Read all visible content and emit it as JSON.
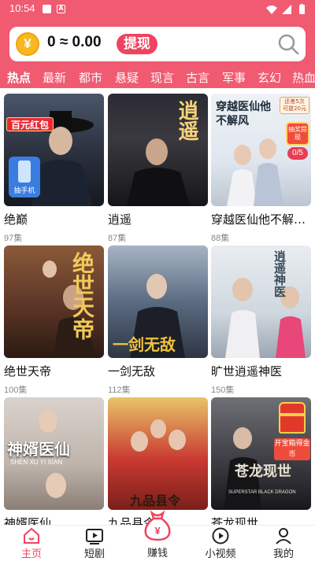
{
  "status_bar": {
    "time": "10:54",
    "notif_badge": "A"
  },
  "header": {
    "coin_symbol": "¥",
    "balance_text": "0 ≈ 0.00",
    "withdraw_label": "提现",
    "accent_color": "#f05b72"
  },
  "tabs": [
    {
      "label": "热点"
    },
    {
      "label": "最新"
    },
    {
      "label": "都市"
    },
    {
      "label": "悬疑"
    },
    {
      "label": "现言"
    },
    {
      "label": "古言"
    },
    {
      "label": "军事"
    },
    {
      "label": "玄幻"
    },
    {
      "label": "热血"
    }
  ],
  "cards": [
    {
      "title": "绝巅",
      "episodes": "97集",
      "poster_text": "",
      "bg": "#2a2f3c"
    },
    {
      "title": "逍遥",
      "episodes": "87集",
      "poster_text": "逍遥",
      "bg": "#3b3940"
    },
    {
      "title": "穿越医仙他不解风情",
      "episodes": "88集",
      "poster_text": "穿越医仙他不解风",
      "bg": "#dfe6ee"
    },
    {
      "title": "绝世天帝",
      "episodes": "100集",
      "poster_text": "绝世天帝",
      "bg": "#5a3526"
    },
    {
      "title": "一剑无敌",
      "episodes": "112集",
      "poster_text": "一剑无敌",
      "bg": "#5b6b82"
    },
    {
      "title": "旷世逍遥神医",
      "episodes": "150集",
      "poster_text": "逍遥神医",
      "bg": "#cfd7df"
    },
    {
      "title": "神婿医仙",
      "episodes": "",
      "poster_text": "神婿医仙",
      "poster_subtext": "SHEN XU YI XIAN",
      "bg": "#bfb4ac"
    },
    {
      "title": "九品县令",
      "episodes": "",
      "poster_text": "九品县令",
      "bg": "#c93a32"
    },
    {
      "title": "苍龙现世",
      "episodes": "",
      "poster_text": "苍龙现世",
      "poster_subtext": "SUPERSTAR BLACK DRAGON",
      "bg": "#3a3a40"
    }
  ],
  "badges": {
    "red_packet": "百元红包",
    "phone_prize": "抽手机",
    "tip_line1": "还差5次",
    "tip_line2": "可提20元",
    "draw_label": "抽奖提现",
    "draw_progress": "0/5",
    "treasure_label": "开宝箱得金币"
  },
  "bottom_nav": [
    {
      "label": "主页",
      "icon": "home-icon",
      "active": true
    },
    {
      "label": "短剧",
      "icon": "play-screen-icon",
      "active": false
    },
    {
      "label": "赚钱",
      "icon": "money-bag-icon",
      "active": false
    },
    {
      "label": "小视频",
      "icon": "play-circle-icon",
      "active": false
    },
    {
      "label": "我的",
      "icon": "user-icon",
      "active": false
    }
  ]
}
